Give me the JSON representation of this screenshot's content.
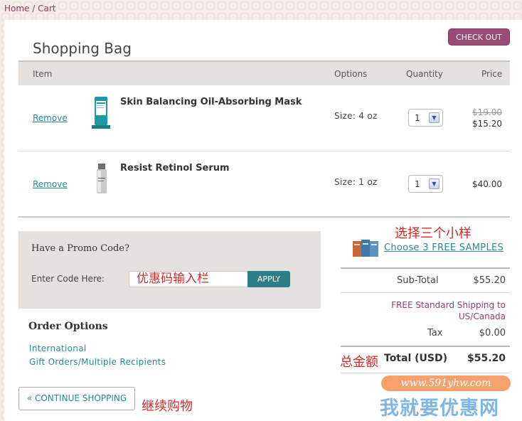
{
  "breadcrumb": {
    "home": "Home",
    "sep": " / ",
    "cart": "Cart"
  },
  "header": {
    "title": "Shopping Bag",
    "checkout": "CHECK OUT"
  },
  "table": {
    "columns": {
      "item": "Item",
      "options": "Options",
      "quantity": "Quantity",
      "price": "Price"
    },
    "rows": [
      {
        "remove": "Remove",
        "name": "Skin Balancing Oil-Absorbing Mask",
        "size": "Size:  4 oz",
        "qty": "1",
        "old_price": "$19.00",
        "price": "$15.20"
      },
      {
        "remove": "Remove",
        "name": "Resist Retinol Serum",
        "size": "Size:  1 oz",
        "qty": "1",
        "old_price": "",
        "price": "$40.00"
      }
    ]
  },
  "promo": {
    "title": "Have a Promo Code?",
    "label": "Enter Code Here:",
    "input_value": "优惠码输入栏",
    "apply": "APPLY"
  },
  "order_options": {
    "title": "Order Options",
    "links": [
      "International",
      "Gift Orders/Multiple Recipients"
    ]
  },
  "continue_button": "« CONTINUE SHOPPING",
  "samples": {
    "link": "Choose 3 FREE SAMPLES"
  },
  "summary": {
    "subtotal_label": "Sub-Total",
    "subtotal_value": "$55.20",
    "shipping_note": "FREE Standard Shipping to US/Canada",
    "tax_label": "Tax",
    "tax_value": "$0.00",
    "total_label": "Total (USD)",
    "total_value": "$55.20"
  },
  "annotations": {
    "samples": "选择三个小样",
    "total": "总金额",
    "continue": "继续购物"
  },
  "watermark": {
    "url": "www.591yhw.com",
    "text": "我就要优惠网"
  },
  "colors": {
    "accent_teal": "#2a8a8f",
    "brand_plum": "#9b4a76",
    "annotation_red": "#d42a2a"
  }
}
